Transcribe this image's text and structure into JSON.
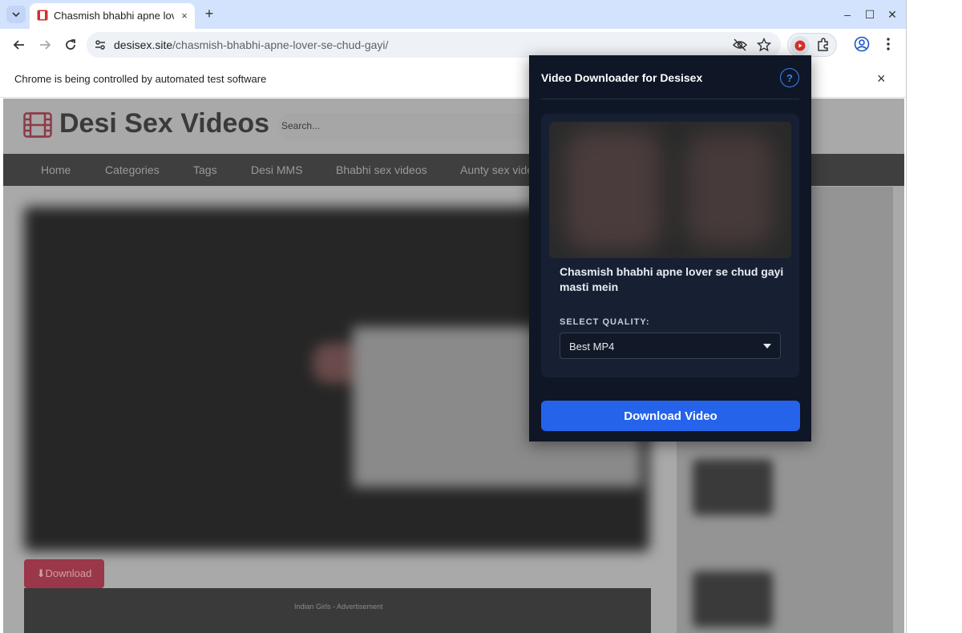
{
  "browser": {
    "tab_title": "Chasmish bhabhi apne lover se chud gayi",
    "new_tab": "+",
    "url_domain": "desisex.site",
    "url_path": "/chasmish-bhabhi-apne-lover-se-chud-gayi/",
    "infobar_message": "Chrome is being controlled by automated test software",
    "close_glyph": "×",
    "minimize_glyph": "–",
    "maximize_glyph": "☐",
    "window_close_glyph": "✕"
  },
  "site": {
    "logo_text": "Desi Sex Videos",
    "search_placeholder": "Search...",
    "nav": [
      "Home",
      "Categories",
      "Tags",
      "Desi MMS",
      "Bhabhi sex videos",
      "Aunty sex videos"
    ],
    "download_button": "⬇Download",
    "ad_text": "Indian Girls - Advertisement"
  },
  "popup": {
    "title": "Video Downloader for Desisex",
    "help": "?",
    "video_title": "Chasmish bhabhi apne lover se chud gayi masti mein",
    "quality_label": "SELECT QUALITY:",
    "quality_value": "Best MP4",
    "download_button": "Download Video"
  },
  "colors": {
    "accent": "#2563eb",
    "popup_bg": "#0f1626",
    "tabbar": "#d3e3fd"
  }
}
